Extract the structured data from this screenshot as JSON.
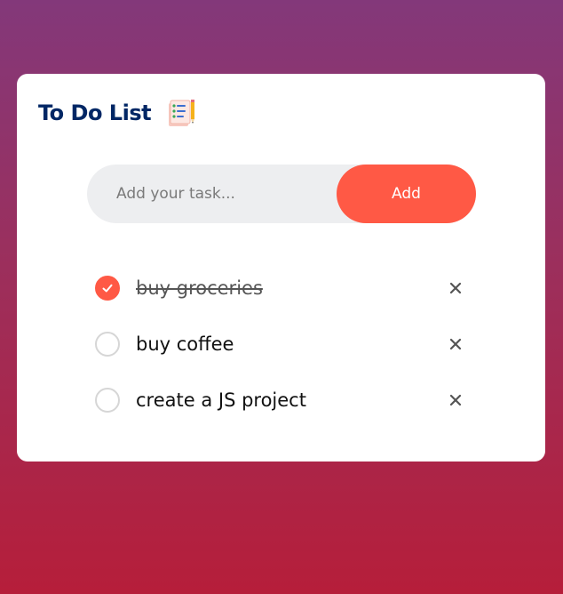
{
  "app": {
    "title": "To Do List",
    "title_icon": "notepad-checklist-icon"
  },
  "input": {
    "placeholder": "Add your task...",
    "value": "",
    "add_label": "Add"
  },
  "tasks": [
    {
      "text": "buy groceries",
      "checked": true
    },
    {
      "text": "buy coffee",
      "checked": false
    },
    {
      "text": "create a JS project",
      "checked": false
    }
  ],
  "colors": {
    "accent": "#ff5945",
    "title": "#002765",
    "background_top": "#83387a",
    "background_bottom": "#b61e3a"
  },
  "icons": {
    "check": "check-icon",
    "delete": "close-icon"
  }
}
